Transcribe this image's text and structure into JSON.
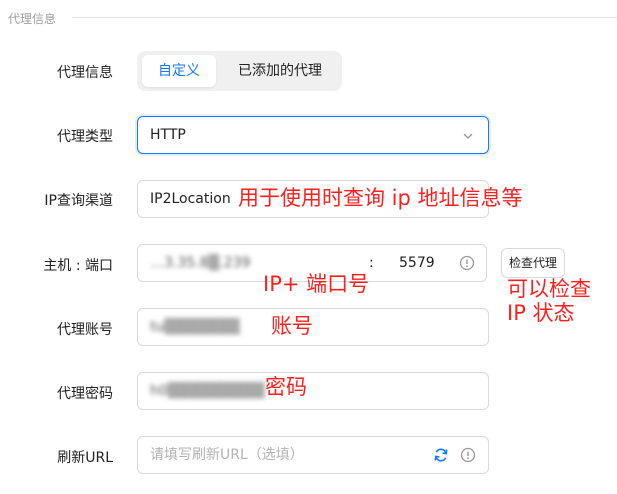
{
  "section": {
    "title": "代理信息"
  },
  "proxy_info": {
    "label": "代理信息",
    "tabs": [
      {
        "label": "自定义",
        "active": true
      },
      {
        "label": "已添加的代理",
        "active": false
      }
    ]
  },
  "proxy_type": {
    "label": "代理类型",
    "value": "HTTP"
  },
  "ip_channel": {
    "label": "IP查询渠道",
    "value": "IP2Location"
  },
  "host_port": {
    "label": "主机 : 端口",
    "host": "…3.35.8▒.239",
    "separator": ":",
    "port": "5579"
  },
  "check_button": {
    "label": "检查代理"
  },
  "account": {
    "label": "代理账号",
    "value": "tu▒▒▒▒▒▒▒"
  },
  "password": {
    "label": "代理密码",
    "value": "h0▒▒▒▒▒▒▒▒▒"
  },
  "refresh_url": {
    "label": "刷新URL",
    "placeholder": "请填写刷新URL（选填）"
  },
  "annotations": {
    "ip_channel_note": "用于使用时查询 ip 地址信息等",
    "host_note": "IP+ 端口号",
    "check_note_1": "可以检查",
    "check_note_2": "IP 状态",
    "account_note": "账号",
    "password_note": "密码"
  },
  "colors": {
    "accent": "#1677ff",
    "annotation": "#ff1f1f",
    "border": "#d9d9d9"
  }
}
